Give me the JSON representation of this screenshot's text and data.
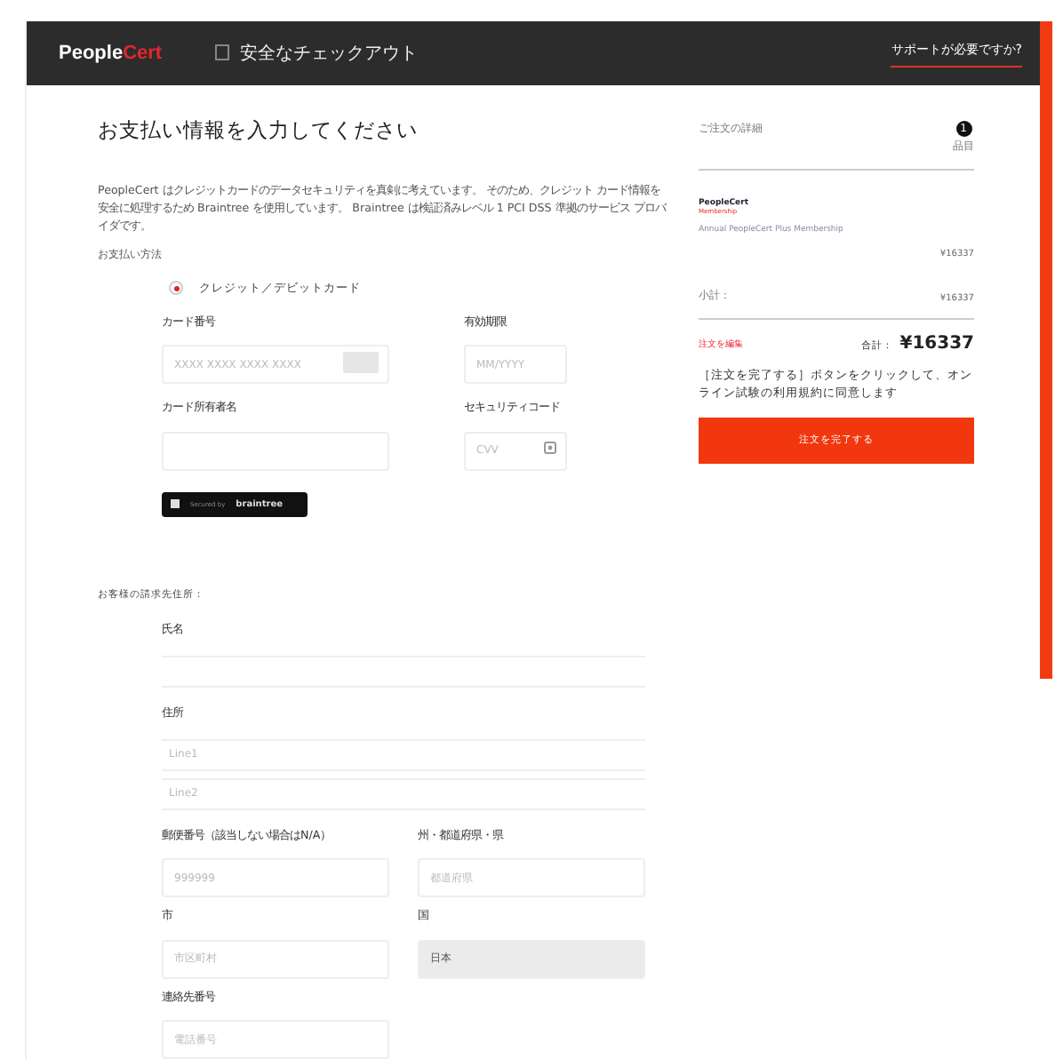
{
  "header": {
    "logo": {
      "part_1": "People",
      "part_2": "Cert"
    },
    "title": "安全なチェックアウト",
    "help_link": "サポートが必要ですか?"
  },
  "payment": {
    "title": "お支払い情報を入力してください",
    "intro": "PeopleCert はクレジットカードのデータセキュリティを真剣に考えています。 そのため、クレジット カード情報を安全に処理するため Braintree を使用しています。 Braintree は検証済みレベル 1 PCI DSS 準拠のサービス プロバイダです。",
    "method_label": "お支払い方法",
    "methods": [
      {
        "label": "クレジット／デビットカード",
        "selected": true
      }
    ],
    "card_fields": [
      {
        "label": "カード番号",
        "placeholder": "XXXX XXXX XXXX XXXX",
        "kind": "card"
      },
      {
        "label": "有効期限",
        "placeholder": "MM/YYYY",
        "kind": "plain"
      },
      {
        "label": "カード所有者名",
        "kind": "plain"
      },
      {
        "label": "セキュリティコード",
        "placeholder": "CVV",
        "kind": "cvv"
      }
    ],
    "badge": {
      "prefix": "Secured by",
      "brand": "braintree"
    }
  },
  "billing": {
    "title": "お客様の請求先住所：",
    "name": {
      "label": "氏名"
    },
    "address": {
      "label": "住所",
      "placeholders": [
        "Line1",
        "Line2"
      ]
    },
    "fields": [
      {
        "label": "郵便番号（該当しない場合はN/A）",
        "placeholder": "999999",
        "disabled": false
      },
      {
        "label": "州・都道府県・県",
        "placeholder": "都道府県",
        "disabled": false
      },
      {
        "label": "市",
        "placeholder": "市区町村",
        "disabled": false
      },
      {
        "label": "国",
        "value": "日本",
        "disabled": true
      },
      {
        "label": "連絡先番号",
        "placeholder": "電話番号",
        "disabled": false
      }
    ]
  },
  "order": {
    "title": "ご注文の詳細",
    "count": "1",
    "count_label": "品目",
    "product_logo": {
      "line_1": "PeopleCert",
      "line_2": "Membership"
    },
    "product": "Annual PeopleCert Plus Membership",
    "price": "¥16337",
    "subtotal_label": "小計：",
    "subtotal": "¥16337",
    "edit_link": "注文を編集",
    "total_label": "合計：",
    "total": "¥16337",
    "terms": "［注文を完了する］ボタンをクリックして、オンライン試験の利用規約に同意します",
    "button": "注文を完了する"
  }
}
